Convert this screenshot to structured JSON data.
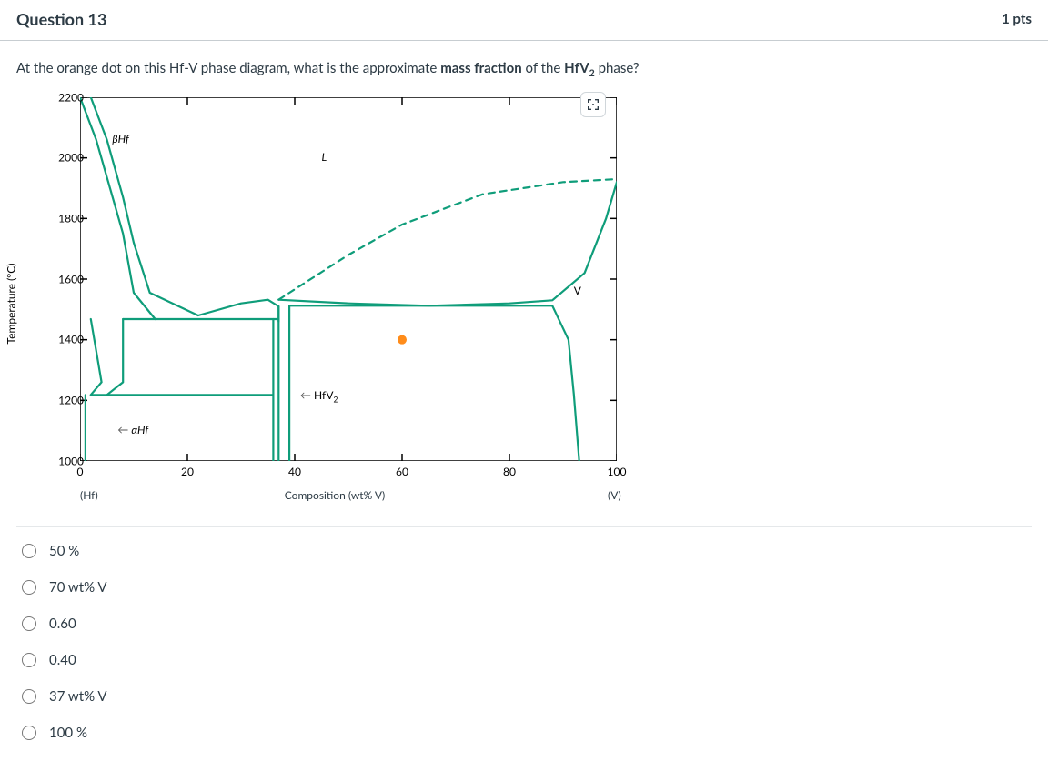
{
  "header": {
    "title": "Question 13",
    "points": "1 pts"
  },
  "stem": {
    "pre": "At the orange dot on this Hf-V phase diagram, what is the approximate ",
    "bold1": "mass fraction",
    "mid": " of the ",
    "bold2_pre": "HfV",
    "bold2_sub": "2",
    "post": " phase?"
  },
  "chart_data": {
    "type": "phase-diagram",
    "title": "Hf-V phase diagram",
    "xlabel": "Composition (wt% V)",
    "ylabel": "Temperature (°C)",
    "x_ticks": [
      0,
      20,
      40,
      60,
      80,
      100
    ],
    "y_ticks": [
      1000,
      1200,
      1400,
      1600,
      1800,
      2000,
      2200
    ],
    "xlim": [
      0,
      100
    ],
    "ylim": [
      1000,
      2200
    ],
    "x_end_left": "(Hf)",
    "x_end_right": "(V)",
    "phase_labels": [
      {
        "text": "βHf",
        "x": 6,
        "y": 2060,
        "italic": true
      },
      {
        "text": "L",
        "x": 45,
        "y": 2000,
        "italic": true
      },
      {
        "text": "V",
        "x": 92,
        "y": 1560,
        "italic": false
      },
      {
        "text": "αHf",
        "x": 7,
        "y": 1100,
        "italic": true,
        "arrow_left": true
      },
      {
        "text": "HfV2",
        "x": 41,
        "y": 1215,
        "sub": "2",
        "arrow_left": true
      }
    ],
    "orange_dot": {
      "x": 60,
      "y": 1400
    },
    "boundaries": [
      {
        "type": "solid",
        "pts": [
          [
            0,
            2200
          ],
          [
            3,
            2060
          ],
          [
            8,
            1750
          ],
          [
            10,
            1555
          ],
          [
            14,
            1468
          ]
        ]
      },
      {
        "type": "solid",
        "pts": [
          [
            2,
            2200
          ],
          [
            5,
            2060
          ],
          [
            8,
            1870
          ],
          [
            10,
            1720
          ],
          [
            13,
            1555
          ],
          [
            22,
            1480
          ],
          [
            30,
            1520
          ],
          [
            35,
            1532
          ],
          [
            37,
            1510
          ],
          [
            37,
            1460
          ]
        ]
      },
      {
        "type": "dashed",
        "pts": [
          [
            37,
            1532
          ],
          [
            50,
            1680
          ],
          [
            60,
            1780
          ],
          [
            75,
            1880
          ],
          [
            90,
            1920
          ],
          [
            100,
            1930
          ]
        ]
      },
      {
        "type": "solid",
        "pts": [
          [
            37,
            1532
          ],
          [
            50,
            1520
          ],
          [
            65,
            1512
          ],
          [
            80,
            1520
          ],
          [
            88,
            1530
          ],
          [
            94,
            1620
          ],
          [
            98,
            1800
          ],
          [
            100,
            1920
          ]
        ]
      },
      {
        "type": "solid",
        "pts": [
          [
            8,
            1468
          ],
          [
            37,
            1468
          ]
        ]
      },
      {
        "type": "solid",
        "pts": [
          [
            39,
            1512
          ],
          [
            88,
            1512
          ]
        ]
      },
      {
        "type": "solid",
        "pts": [
          [
            88,
            1512
          ],
          [
            91,
            1400
          ],
          [
            92,
            1220
          ],
          [
            93,
            1000
          ]
        ]
      },
      {
        "type": "solid",
        "pts": [
          [
            2,
            1218
          ],
          [
            36,
            1218
          ]
        ]
      },
      {
        "type": "solid",
        "pts": [
          [
            1,
            1218
          ],
          [
            1,
            1000
          ]
        ]
      },
      {
        "type": "solid",
        "pts": [
          [
            2,
            1468
          ],
          [
            4,
            1260
          ],
          [
            2,
            1218
          ]
        ]
      },
      {
        "type": "solid",
        "pts": [
          [
            8,
            1468
          ],
          [
            8,
            1260
          ],
          [
            5,
            1218
          ]
        ]
      },
      {
        "type": "solid",
        "pts": [
          [
            36,
            1468
          ],
          [
            36,
            1000
          ]
        ]
      },
      {
        "type": "solid",
        "pts": [
          [
            37,
            1510
          ],
          [
            37,
            1000
          ]
        ]
      },
      {
        "type": "solid",
        "pts": [
          [
            39,
            1512
          ],
          [
            39,
            1000
          ]
        ]
      }
    ]
  },
  "answers": [
    "50 %",
    "70 wt% V",
    "0.60",
    "0.40",
    "37 wt% V",
    "100 %"
  ]
}
